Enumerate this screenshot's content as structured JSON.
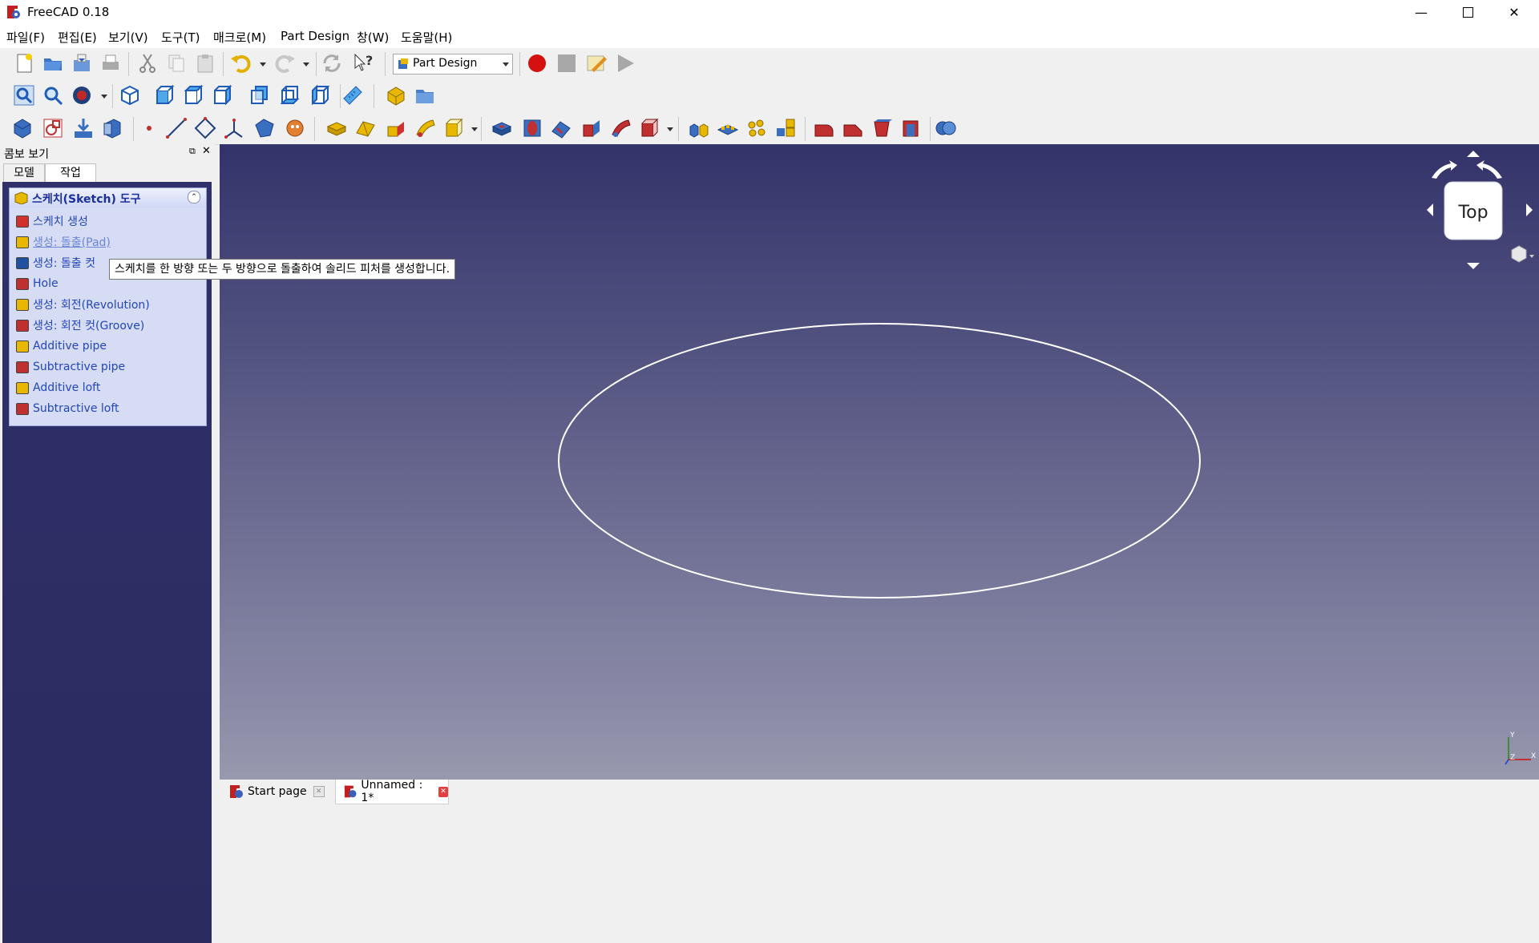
{
  "window": {
    "title": "FreeCAD 0.18"
  },
  "menu": [
    "파일(F)",
    "편집(E)",
    "보기(V)",
    "도구(T)",
    "매크로(M)",
    "Part Design",
    "창(W)",
    "도움말(H)"
  ],
  "workbench": {
    "selected": "Part Design"
  },
  "combo_view": {
    "title": "콤보 보기",
    "tabs": [
      "모델",
      "작업"
    ]
  },
  "task_panel": {
    "header": "스케치(Sketch) 도구",
    "items": [
      {
        "label": "스케치 생성",
        "icon": "sketch-create-icon",
        "color": "#d03030"
      },
      {
        "label": "생성: 돌출(Pad)",
        "icon": "pad-icon",
        "color": "#e8b800"
      },
      {
        "label": "생성: 돌출 컷",
        "icon": "pocket-icon",
        "color": "#2050a0"
      },
      {
        "label": "Hole",
        "icon": "hole-icon",
        "color": "#c03030"
      },
      {
        "label": "생성: 회전(Revolution)",
        "icon": "revolution-icon",
        "color": "#e8b800"
      },
      {
        "label": "생성: 회전 컷(Groove)",
        "icon": "groove-icon",
        "color": "#c03030"
      },
      {
        "label": "Additive pipe",
        "icon": "additive-pipe-icon",
        "color": "#e8b800"
      },
      {
        "label": "Subtractive pipe",
        "icon": "subtractive-pipe-icon",
        "color": "#c03030"
      },
      {
        "label": "Additive loft",
        "icon": "additive-loft-icon",
        "color": "#e8b800"
      },
      {
        "label": "Subtractive loft",
        "icon": "subtractive-loft-icon",
        "color": "#c03030"
      }
    ]
  },
  "tooltip": "스케치를 한 방향 또는 두 방향으로 돌출하여 솔리드 피처를 생성합니다.",
  "navcube": {
    "face": "Top"
  },
  "doc_tabs": [
    {
      "label": "Start page"
    },
    {
      "label": "Unnamed : 1*"
    }
  ],
  "colors": {
    "viewport_top": "#33336a",
    "viewport_bottom": "#9898ae",
    "task_link": "#2346b8",
    "accent_red": "#d41010",
    "part_yellow": "#e8b800"
  }
}
